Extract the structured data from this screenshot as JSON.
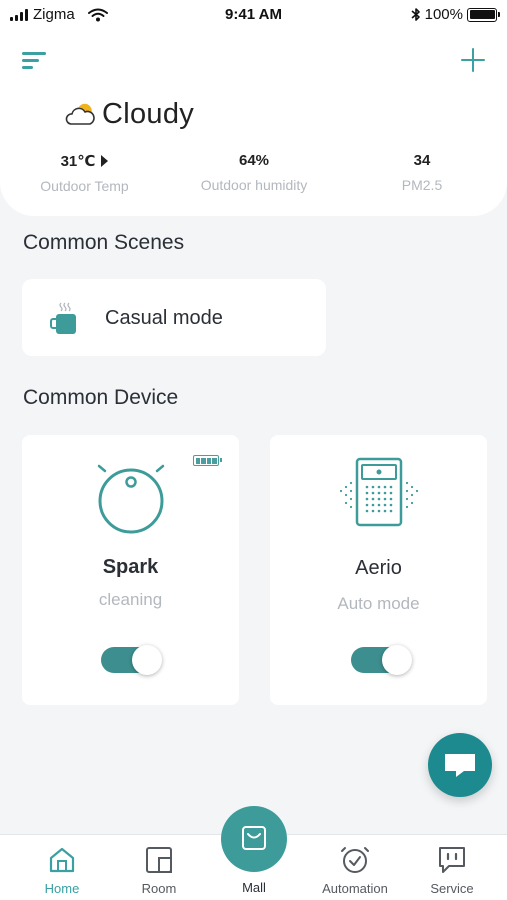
{
  "status_bar": {
    "carrier": "Zigma",
    "time": "9:41 AM",
    "battery": "100%"
  },
  "weather": {
    "condition": "Cloudy",
    "stats": [
      {
        "value": "31℃",
        "label": "Outdoor Temp"
      },
      {
        "value": "64%",
        "label": "Outdoor humidity"
      },
      {
        "value": "34",
        "label": "PM2.5"
      }
    ]
  },
  "scenes": {
    "title": "Common Scenes",
    "items": [
      {
        "label": "Casual mode",
        "icon": "coffee-cup-icon"
      }
    ]
  },
  "devices": {
    "title": "Common Device",
    "items": [
      {
        "name": "Spark",
        "status": "cleaning",
        "icon": "robot-vacuum-icon",
        "on": true
      },
      {
        "name": "Aerio",
        "status": "Auto mode",
        "icon": "air-purifier-icon",
        "on": true
      }
    ]
  },
  "nav": {
    "items": [
      {
        "label": "Home",
        "icon": "home-icon",
        "active": true
      },
      {
        "label": "Room",
        "icon": "room-icon",
        "active": false
      },
      {
        "label": "Mall",
        "icon": "shopping-bag-icon",
        "active": false
      },
      {
        "label": "Automation",
        "icon": "alarm-clock-icon",
        "active": false
      },
      {
        "label": "Service",
        "icon": "service-chat-icon",
        "active": false
      }
    ]
  },
  "colors": {
    "accent": "#3aa0a2",
    "toggle_on": "#3d8f8f",
    "chat_fab": "#1d8a90",
    "weather_sun": "#f2b21c"
  }
}
